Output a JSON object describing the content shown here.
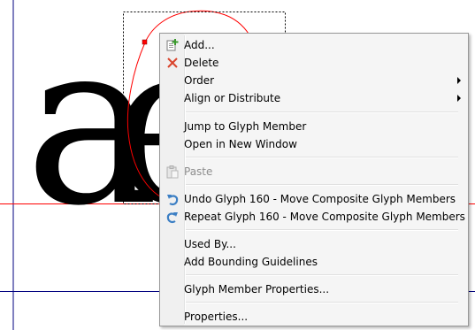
{
  "glyph_preview": {
    "letter_a": "a",
    "letter_e": "e"
  },
  "context_menu": {
    "items": [
      {
        "label": "Add...",
        "icon": "add-icon",
        "enabled": true
      },
      {
        "label": "Delete",
        "icon": "delete-icon",
        "enabled": true
      },
      {
        "label": "Order",
        "submenu": true,
        "enabled": true
      },
      {
        "label": "Align or Distribute",
        "submenu": true,
        "enabled": true
      },
      {
        "label": "Jump to Glyph Member",
        "enabled": true
      },
      {
        "label": "Open in New Window",
        "enabled": true
      },
      {
        "label": "Paste",
        "icon": "paste-icon",
        "enabled": false
      },
      {
        "label": "Undo Glyph 160 - Move Composite Glyph Members",
        "icon": "undo-icon",
        "enabled": true
      },
      {
        "label": "Repeat Glyph 160 - Move Composite Glyph Members",
        "icon": "redo-icon",
        "enabled": true
      },
      {
        "label": "Used By...",
        "enabled": true
      },
      {
        "label": "Add Bounding Guidelines",
        "enabled": true
      },
      {
        "label": "Glyph Member Properties...",
        "enabled": true
      },
      {
        "label": "Properties...",
        "enabled": true
      }
    ]
  },
  "colors": {
    "guideline_red": "#ff0000",
    "guideline_blue": "#00007f",
    "add_icon_green": "#3a9a2c",
    "delete_icon_red": "#d9442c",
    "undo_icon_blue": "#3c7fc4"
  }
}
